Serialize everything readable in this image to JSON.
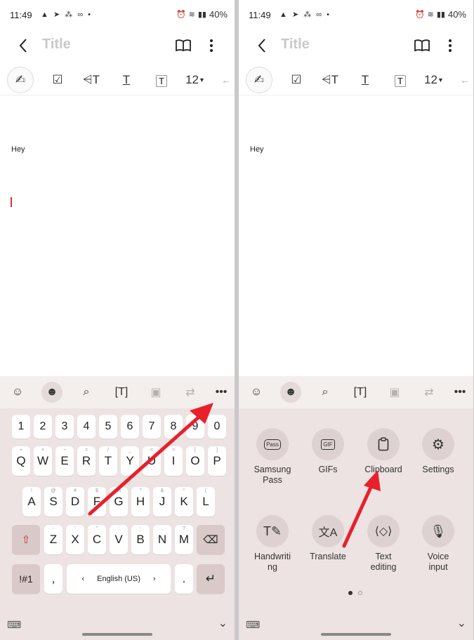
{
  "status": {
    "time": "11:49",
    "left_icons": "▲ ➤ ⁂ ∞ •",
    "battery": "40%"
  },
  "app": {
    "title_placeholder": "Title"
  },
  "toolbar": {
    "font_size": "12"
  },
  "note": {
    "text": "Hey"
  },
  "keyboard": {
    "number_row": [
      "1",
      "2",
      "3",
      "4",
      "5",
      "6",
      "7",
      "8",
      "9",
      "0"
    ],
    "row1": [
      "Q",
      "W",
      "E",
      "R",
      "T",
      "Y",
      "U",
      "I",
      "O",
      "P"
    ],
    "row1_sub": [
      "+",
      "×",
      "÷",
      "=",
      "/",
      "_",
      "<",
      ">",
      "[",
      "]"
    ],
    "row2": [
      "A",
      "S",
      "D",
      "F",
      "G",
      "H",
      "J",
      "K",
      "L"
    ],
    "row2_sub": [
      "!",
      "@",
      "#",
      "$",
      "%",
      "^",
      "&",
      "*",
      "(",
      ")"
    ],
    "row3": [
      "Z",
      "X",
      "C",
      "V",
      "B",
      "N",
      "M"
    ],
    "row3_sub": [
      "-",
      "'",
      "\"",
      ":",
      ";",
      ",",
      "?"
    ],
    "symbols_label": "!#1",
    "comma_label": ",",
    "space_label": "English (US)",
    "period_label": "."
  },
  "panel": {
    "items": [
      {
        "label": "Samsung\nPass",
        "icon": "pass-icon"
      },
      {
        "label": "GIFs",
        "icon": "gif-icon"
      },
      {
        "label": "Clipboard",
        "icon": "clipboard-icon"
      },
      {
        "label": "Settings",
        "icon": "gear-icon"
      },
      {
        "label": "Handwriti\nng",
        "icon": "handwriting-icon"
      },
      {
        "label": "Translate",
        "icon": "translate-icon"
      },
      {
        "label": "Text\nediting",
        "icon": "text-editing-icon"
      },
      {
        "label": "Voice\ninput",
        "icon": "mic-icon"
      }
    ]
  },
  "colors": {
    "annotation_arrow": "#e8202a",
    "keyboard_bg": "#ece3e2",
    "fn_key": "#d9c9c8"
  }
}
